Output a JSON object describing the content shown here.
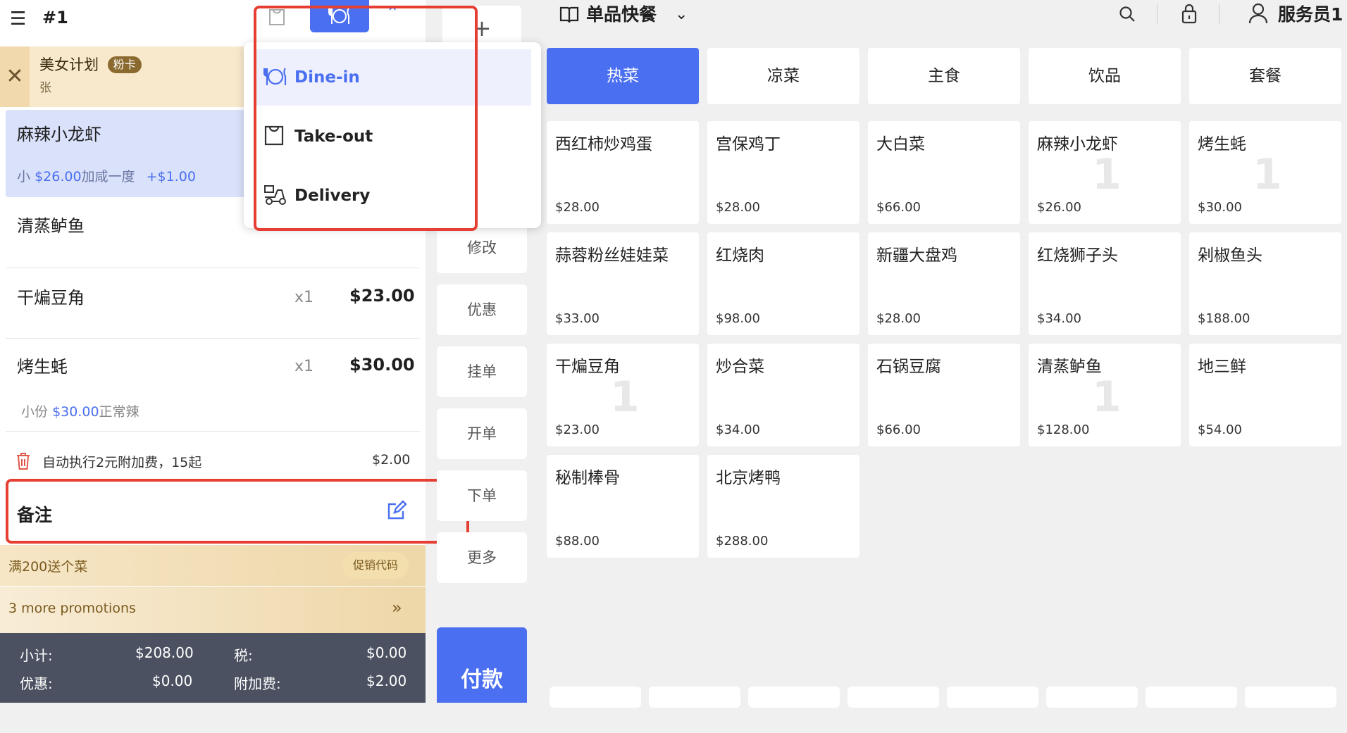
{
  "header": {
    "order_number": "#1",
    "store_name": "单品快餐",
    "staff_name": "服务员1"
  },
  "member": {
    "name": "美女计划",
    "badge": "粉卡",
    "sub": "张"
  },
  "order_items": [
    {
      "name": "麻辣小龙虾",
      "detail_size": "小",
      "detail_price": "$26.00",
      "detail_note": "加咸一度",
      "detail_extra": "+$1.00"
    },
    {
      "name": "清蒸鲈鱼"
    },
    {
      "name": "干煸豆角",
      "qty": "x1",
      "price": "$23.00"
    },
    {
      "name": "烤生蚝",
      "qty": "x1",
      "price": "$30.00",
      "detail_size": "小份",
      "detail_price": "$30.00",
      "detail_note": "正常辣"
    }
  ],
  "surcharge": {
    "text": "自动执行2元附加费，15起",
    "amount": "$2.00"
  },
  "note": {
    "label": "备注"
  },
  "promotions": {
    "line1": "满200送个菜",
    "code_button": "促销代码",
    "line2": "3 more promotions"
  },
  "summary": {
    "subtotal_label": "小计:",
    "subtotal": "$208.00",
    "tax_label": "税:",
    "tax": "$0.00",
    "discount_label": "优惠:",
    "discount": "$0.00",
    "fee_label": "附加费:",
    "fee": "$2.00"
  },
  "actions": {
    "plus": "+",
    "modify": "修改",
    "discount": "优惠",
    "hold": "挂单",
    "open": "开单",
    "place": "下单",
    "more": "更多",
    "pay": "付款"
  },
  "dropdown": {
    "items": [
      {
        "label": "Dine-in",
        "icon": "dine-in-icon"
      },
      {
        "label": "Take-out",
        "icon": "bag-icon"
      },
      {
        "label": "Delivery",
        "icon": "delivery-scooter-icon"
      }
    ]
  },
  "categories": [
    "热菜",
    "凉菜",
    "主食",
    "饮品",
    "套餐"
  ],
  "menu": [
    {
      "name": "西红柿炒鸡蛋",
      "price": "$28.00",
      "count": ""
    },
    {
      "name": "宫保鸡丁",
      "price": "$28.00",
      "count": ""
    },
    {
      "name": "大白菜",
      "price": "$66.00",
      "count": ""
    },
    {
      "name": "麻辣小龙虾",
      "price": "$26.00",
      "count": "1"
    },
    {
      "name": "烤生蚝",
      "price": "$30.00",
      "count": "1"
    },
    {
      "name": "蒜蓉粉丝娃娃菜",
      "price": "$33.00",
      "count": ""
    },
    {
      "name": "红烧肉",
      "price": "$98.00",
      "count": ""
    },
    {
      "name": "新疆大盘鸡",
      "price": "$28.00",
      "count": ""
    },
    {
      "name": "红烧狮子头",
      "price": "$34.00",
      "count": ""
    },
    {
      "name": "剁椒鱼头",
      "price": "$188.00",
      "count": ""
    },
    {
      "name": "干煸豆角",
      "price": "$23.00",
      "count": "1"
    },
    {
      "name": "炒合菜",
      "price": "$34.00",
      "count": ""
    },
    {
      "name": "石锅豆腐",
      "price": "$66.00",
      "count": ""
    },
    {
      "name": "清蒸鲈鱼",
      "price": "$128.00",
      "count": "1"
    },
    {
      "name": "地三鲜",
      "price": "$54.00",
      "count": ""
    },
    {
      "name": "秘制棒骨",
      "price": "$88.00",
      "count": ""
    },
    {
      "name": "北京烤鸭",
      "price": "$288.00",
      "count": ""
    }
  ],
  "colors": {
    "accent": "#4a6ff0",
    "highlight": "#e53f33",
    "summary_bg": "#4b5161"
  }
}
